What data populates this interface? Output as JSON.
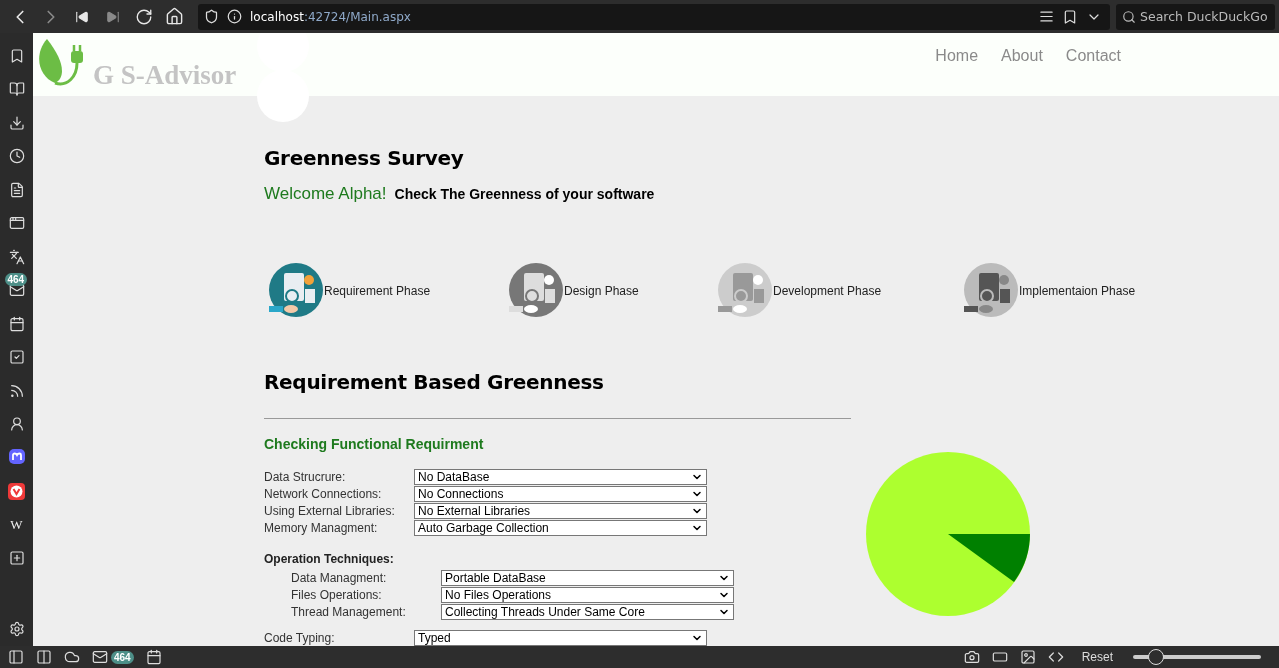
{
  "browser": {
    "url_host": "localhost",
    "url_rest": ":42724/Main.aspx",
    "search_placeholder": "Search DuckDuckGo"
  },
  "sidebar": {
    "mail_badge": "464",
    "wiki_label": "W"
  },
  "header": {
    "brand": "G S-Advisor",
    "nav": [
      "Home",
      "About",
      "Contact"
    ]
  },
  "page": {
    "title": "Greenness Survey",
    "welcome": "Welcome Alpha!",
    "tagline": "Check The Greenness of your software",
    "phases": [
      {
        "label": "Requirement Phase",
        "kind": "picture"
      },
      {
        "label": "Design Phase",
        "kind": "picture"
      },
      {
        "label": "Development Phase",
        "kind": "picture"
      },
      {
        "label": "Implementaion Phase",
        "kind": "picture"
      }
    ],
    "section_title": "Requirement Based Greenness",
    "subsection_title": "Checking Functional Requirment",
    "fields": [
      {
        "label": "Data Strucrure:",
        "value": "No DataBase"
      },
      {
        "label": "Network Connections:",
        "value": "No Connections"
      },
      {
        "label": "Using External Libraries:",
        "value": "No External Libraries"
      },
      {
        "label": "Memory Managment:",
        "value": "Auto Garbage Collection"
      }
    ],
    "operation_title": "Operation Techniques:",
    "operation_fields": [
      {
        "label": "Data Managment:",
        "value": "Portable DataBase"
      },
      {
        "label": "Files Operations:",
        "value": "No Files Operations"
      },
      {
        "label": "Thread Management:",
        "value": "Collecting Threads Under Same Core"
      }
    ],
    "more_fields": [
      {
        "label": "Code Typing:",
        "value": "Typed"
      }
    ]
  },
  "status_bar": {
    "mail_badge": "464",
    "reset": "Reset",
    "zoom": {
      "level": 0.18
    }
  }
}
